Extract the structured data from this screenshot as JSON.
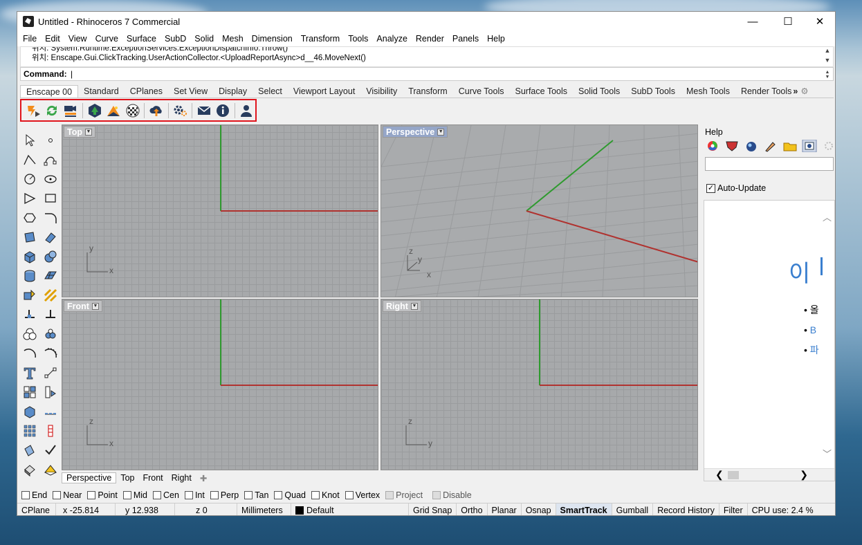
{
  "window": {
    "title": "Untitled - Rhinoceros 7 Commercial",
    "minimize": "—",
    "maximize": "☐",
    "close": "✕"
  },
  "menu": [
    "File",
    "Edit",
    "View",
    "Curve",
    "Surface",
    "SubD",
    "Solid",
    "Mesh",
    "Dimension",
    "Transform",
    "Tools",
    "Analyze",
    "Render",
    "Panels",
    "Help"
  ],
  "history": [
    "위치: System.Runtime.ExceptionServices.ExceptionDispatchInfo.Throw()",
    "위치: Enscape.Gui.ClickTracking.UserActionCollector.<UploadReportAsync>d__46.MoveNext()"
  ],
  "command": {
    "label": "Command:"
  },
  "toolbar_tabs": [
    "Enscape 00",
    "Standard",
    "CPlanes",
    "Set View",
    "Display",
    "Select",
    "Viewport Layout",
    "Visibility",
    "Transform",
    "Curve Tools",
    "Surface Tools",
    "Solid Tools",
    "SubD Tools",
    "Mesh Tools",
    "Render Tools"
  ],
  "tabs_more": "»",
  "enscape_icons": [
    "enscape-start-icon",
    "live-update-icon",
    "sync-views-icon",
    "views-icon",
    "asset-library-icon",
    "material-editor-icon",
    "upload-icon",
    "settings-icon",
    "feedback-icon",
    "about-icon",
    "account-icon"
  ],
  "viewports": {
    "top": {
      "label": "Top",
      "axis1": "y",
      "axis2": "x"
    },
    "perspective": {
      "label": "Perspective",
      "axis1": "z",
      "axis2": "y",
      "axis3": "x"
    },
    "front": {
      "label": "Front",
      "axis1": "z",
      "axis2": "x"
    },
    "right": {
      "label": "Right",
      "axis1": "z",
      "axis2": "y"
    }
  },
  "viewport_tabs": [
    "Perspective",
    "Top",
    "Front",
    "Right"
  ],
  "viewport_tab_add": "✚",
  "panel": {
    "title": "Help",
    "auto_update": "Auto-Update",
    "content_big": "이",
    "bullets": [
      "올",
      "B",
      "파"
    ],
    "bullet_colors": [
      "#333333",
      "#3a7fcf",
      "#3a7fcf"
    ]
  },
  "osnaps": [
    {
      "label": "End",
      "disabled": false
    },
    {
      "label": "Near",
      "disabled": false
    },
    {
      "label": "Point",
      "disabled": false
    },
    {
      "label": "Mid",
      "disabled": false
    },
    {
      "label": "Cen",
      "disabled": false
    },
    {
      "label": "Int",
      "disabled": false
    },
    {
      "label": "Perp",
      "disabled": false
    },
    {
      "label": "Tan",
      "disabled": false
    },
    {
      "label": "Quad",
      "disabled": false
    },
    {
      "label": "Knot",
      "disabled": false
    },
    {
      "label": "Vertex",
      "disabled": false
    },
    {
      "label": "Project",
      "disabled": true
    },
    {
      "label": "Disable",
      "disabled": true
    }
  ],
  "status": {
    "cplane": "CPlane",
    "x": "x -25.814",
    "y": "y 12.938",
    "z": "z 0",
    "units": "Millimeters",
    "layer": "Default",
    "toggles": [
      "Grid Snap",
      "Ortho",
      "Planar",
      "Osnap",
      "SmartTrack",
      "Gumball",
      "Record History",
      "Filter"
    ],
    "active_toggle": "SmartTrack",
    "cpu": "CPU use: 2.4 %"
  },
  "colors": {
    "x_axis": "#b0322f",
    "y_axis": "#2f9a2f",
    "highlight": "#e0141c"
  }
}
